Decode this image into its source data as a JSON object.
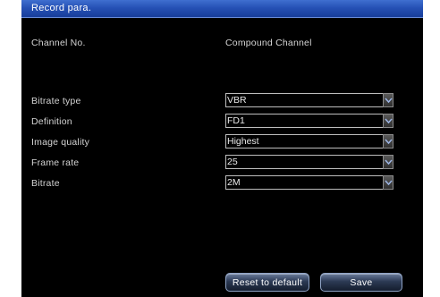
{
  "window": {
    "title": "Record para."
  },
  "channel": {
    "label": "Channel No.",
    "value": "Compound Channel"
  },
  "fields": [
    {
      "label": "Bitrate type",
      "value": "VBR"
    },
    {
      "label": "Definition",
      "value": "FD1"
    },
    {
      "label": "Image quality",
      "value": "Highest"
    },
    {
      "label": "Frame rate",
      "value": "25"
    },
    {
      "label": "Bitrate",
      "value": "2M"
    }
  ],
  "buttons": {
    "reset": "Reset to default",
    "save": "Save"
  },
  "colors": {
    "title_bar": "#2550b4",
    "background": "#000000",
    "text": "#d4d4d4"
  }
}
